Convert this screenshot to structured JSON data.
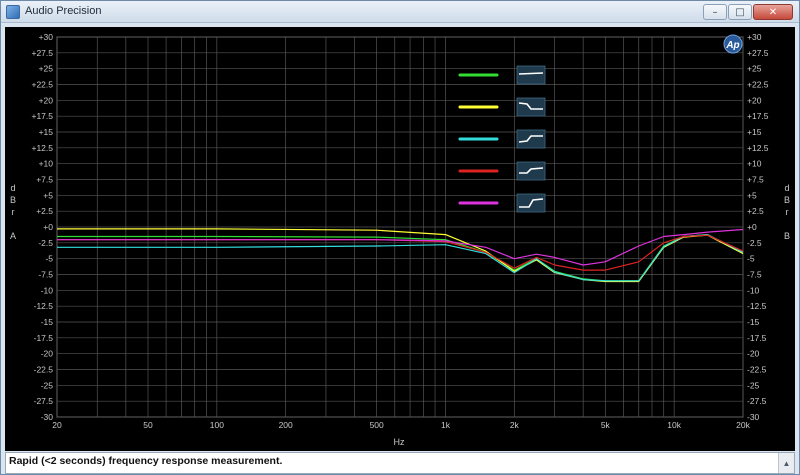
{
  "window": {
    "title": "Audio Precision"
  },
  "window_buttons": {
    "minimize": "–",
    "maximize": "□",
    "close": "✕"
  },
  "status": {
    "message": "Rapid (<2 seconds) frequency response measurement."
  },
  "graph": {
    "logo_text": "Ap",
    "axis_unit_vertical": "d\nB\nr\n \nA",
    "axis_unit_vertical_right": "d\nB\nr\n \nB"
  },
  "chart_data": {
    "type": "line",
    "xlabel": "Hz",
    "x_scale": "log",
    "xlim": [
      20,
      20000
    ],
    "x_ticks": [
      {
        "value": 20,
        "label": "20"
      },
      {
        "value": 50,
        "label": "50"
      },
      {
        "value": 100,
        "label": "100"
      },
      {
        "value": 200,
        "label": "200"
      },
      {
        "value": 500,
        "label": "500"
      },
      {
        "value": 1000,
        "label": "1k"
      },
      {
        "value": 2000,
        "label": "2k"
      },
      {
        "value": 5000,
        "label": "5k"
      },
      {
        "value": 10000,
        "label": "10k"
      },
      {
        "value": 20000,
        "label": "20k"
      }
    ],
    "ylabel_left": "dBrA",
    "ylabel_right": "dBrB",
    "ylim": [
      -30,
      30
    ],
    "y_ticks": [
      "+30",
      "+27.5",
      "+25",
      "+22.5",
      "+20",
      "+17.5",
      "+15",
      "+12.5",
      "+10",
      "+7.5",
      "+5",
      "+2.5",
      "+0",
      "-2.5",
      "-5",
      "-7.5",
      "-10",
      "-12.5",
      "-15",
      "-17.5",
      "-20",
      "-22.5",
      "-25",
      "-27.5",
      "-30"
    ],
    "grid": true,
    "legend_position": "top-center",
    "series": [
      {
        "color": "#33dd33",
        "x": [
          20,
          100,
          500,
          1000,
          1500,
          2000,
          2500,
          3000,
          4000,
          5000,
          7000,
          9000,
          11000,
          14000,
          20000
        ],
        "y": [
          -1.5,
          -1.5,
          -1.6,
          -2.0,
          -4.0,
          -6.8,
          -5.0,
          -7.0,
          -8.2,
          -8.5,
          -8.5,
          -3.0,
          -1.5,
          -1.2,
          -4.0
        ]
      },
      {
        "color": "#ffff33",
        "x": [
          20,
          100,
          500,
          1000,
          1500,
          2000,
          2500,
          3000,
          4000,
          5000,
          7000,
          9000,
          11000,
          14000,
          20000
        ],
        "y": [
          -0.3,
          -0.3,
          -0.5,
          -1.2,
          -3.8,
          -7.0,
          -5.2,
          -7.2,
          -8.3,
          -8.6,
          -8.6,
          -3.2,
          -1.6,
          -1.3,
          -4.2
        ]
      },
      {
        "color": "#33dddd",
        "x": [
          20,
          100,
          500,
          1000,
          1500,
          2000,
          2500,
          3000,
          4000,
          5000,
          7000,
          9000,
          11000,
          14000,
          20000
        ],
        "y": [
          -3.2,
          -3.2,
          -3.0,
          -2.8,
          -4.2,
          -7.2,
          -5.0,
          -7.1,
          -8.3,
          -8.5,
          -8.5,
          -3.1,
          -1.5,
          -1.2,
          -4.0
        ]
      },
      {
        "color": "#dd2222",
        "x": [
          20,
          100,
          500,
          1000,
          1500,
          2000,
          2500,
          3000,
          4000,
          5000,
          7000,
          9000,
          11000,
          14000,
          20000
        ],
        "y": [
          -2.0,
          -2.0,
          -2.0,
          -2.3,
          -4.0,
          -6.5,
          -4.8,
          -6.0,
          -6.8,
          -6.8,
          -5.5,
          -2.5,
          -1.5,
          -1.3,
          -3.8
        ]
      },
      {
        "color": "#dd33dd",
        "x": [
          20,
          100,
          500,
          1000,
          1500,
          2000,
          2500,
          3000,
          4000,
          5000,
          7000,
          9000,
          11000,
          14000,
          20000
        ],
        "y": [
          -2.0,
          -2.0,
          -2.0,
          -2.2,
          -3.2,
          -5.0,
          -4.3,
          -4.8,
          -6.0,
          -5.5,
          -3.0,
          -1.5,
          -1.2,
          -0.8,
          -0.4
        ]
      }
    ]
  }
}
